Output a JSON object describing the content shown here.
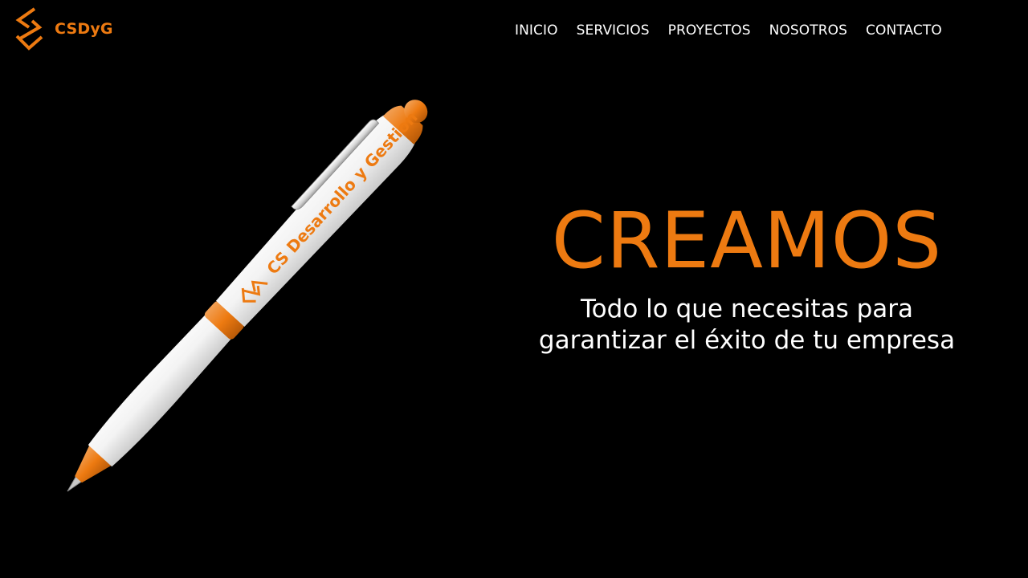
{
  "theme": {
    "accent": "#ED7A11",
    "background": "#000000",
    "text": "#FFFFFF"
  },
  "brand": {
    "name": "CSDyG",
    "logo_icon": "stacked-chevrons-logo-icon"
  },
  "nav": {
    "items": [
      {
        "label": "INICIO"
      },
      {
        "label": "SERVICIOS"
      },
      {
        "label": "PROYECTOS"
      },
      {
        "label": "NOSOTROS"
      },
      {
        "label": "CONTACTO"
      }
    ]
  },
  "hero": {
    "pen_imprint": "CS Desarrollo y Gestion",
    "title": "CREAMOS",
    "subtitle_line1": "Todo lo que necesitas para",
    "subtitle_line2": "garantizar el éxito de tu empresa"
  }
}
